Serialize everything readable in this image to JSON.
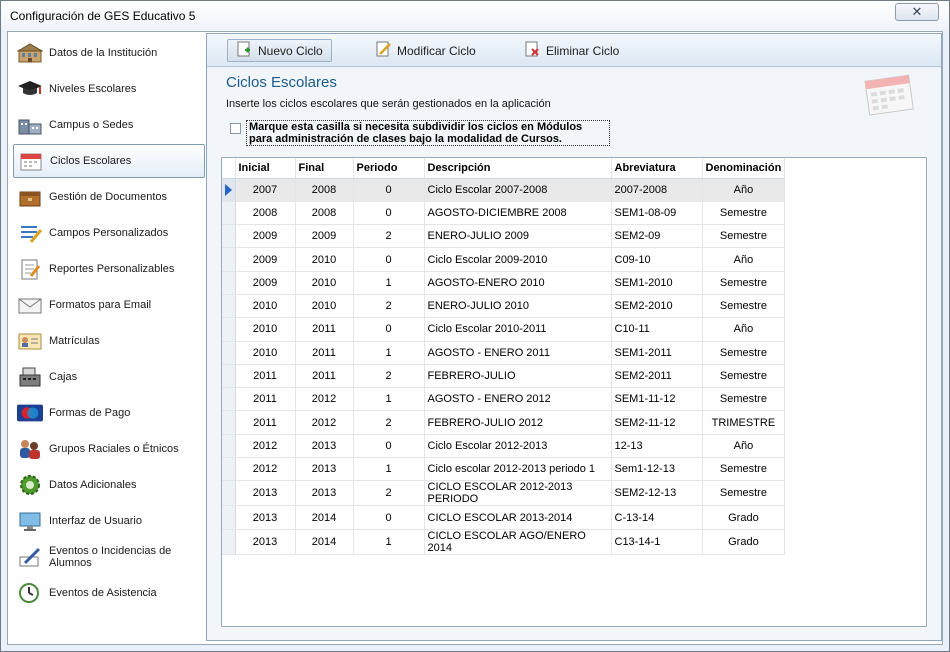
{
  "window": {
    "title": "Configuración de GES Educativo 5",
    "close_glyph": "✕"
  },
  "sidebar": {
    "items": [
      {
        "label": "Datos de la Institución",
        "icon": "school-building-icon"
      },
      {
        "label": "Niveles Escolares",
        "icon": "graduation-cap-icon"
      },
      {
        "label": "Campus o Sedes",
        "icon": "campus-buildings-icon"
      },
      {
        "label": "Ciclos Escolares",
        "icon": "calendar-icon",
        "active": true
      },
      {
        "label": "Gestión de Documentos",
        "icon": "document-box-icon"
      },
      {
        "label": "Campos Personalizados",
        "icon": "custom-fields-icon"
      },
      {
        "label": "Reportes Personalizables",
        "icon": "report-icon"
      },
      {
        "label": "Formatos para Email",
        "icon": "email-icon"
      },
      {
        "label": "Matrículas",
        "icon": "id-card-icon"
      },
      {
        "label": "Cajas",
        "icon": "cash-register-icon"
      },
      {
        "label": "Formas de Pago",
        "icon": "maestro-card-icon"
      },
      {
        "label": "Grupos Raciales o Étnicos",
        "icon": "people-group-icon"
      },
      {
        "label": "Datos Adicionales",
        "icon": "gear-icon"
      },
      {
        "label": "Interfaz de Usuario",
        "icon": "monitor-icon"
      },
      {
        "label": "Eventos o Incidencias de Alumnos",
        "icon": "pen-note-icon"
      },
      {
        "label": "Eventos de Asistencia",
        "icon": "clock-icon"
      }
    ]
  },
  "toolbar": {
    "new_label": "Nuevo Ciclo",
    "edit_label": "Modificar Ciclo",
    "delete_label": "Eliminar Ciclo"
  },
  "content": {
    "heading": "Ciclos Escolares",
    "subtitle": "Inserte los ciclos escolares que serán gestionados en la aplicación",
    "checkbox_label": "Marque esta casilla si necesita subdividir los ciclos en Módulos para administración de clases bajo la modalidad de Cursos.",
    "checkbox_checked": false
  },
  "grid": {
    "columns": [
      "Inicial",
      "Final",
      "Periodo",
      "Descripción",
      "Abreviatura",
      "Denominación"
    ],
    "rows": [
      [
        "2007",
        "2008",
        "0",
        "Ciclo Escolar 2007-2008",
        "2007-2008",
        "Año"
      ],
      [
        "2008",
        "2008",
        "0",
        "AGOSTO-DICIEMBRE 2008",
        "SEM1-08-09",
        "Semestre"
      ],
      [
        "2009",
        "2009",
        "2",
        "ENERO-JULIO 2009",
        "SEM2-09",
        "Semestre"
      ],
      [
        "2009",
        "2010",
        "0",
        "Ciclo Escolar 2009-2010",
        "C09-10",
        "Año"
      ],
      [
        "2009",
        "2010",
        "1",
        "AGOSTO-ENERO 2010",
        "SEM1-2010",
        "Semestre"
      ],
      [
        "2010",
        "2010",
        "2",
        "ENERO-JULIO 2010",
        "SEM2-2010",
        "Semestre"
      ],
      [
        "2010",
        "2011",
        "0",
        "Ciclo Escolar 2010-2011",
        "C10-11",
        "Año"
      ],
      [
        "2010",
        "2011",
        "1",
        "AGOSTO - ENERO 2011",
        "SEM1-2011",
        "Semestre"
      ],
      [
        "2011",
        "2011",
        "2",
        "FEBRERO-JULIO",
        "SEM2-2011",
        "Semestre"
      ],
      [
        "2011",
        "2012",
        "1",
        "AGOSTO - ENERO 2012",
        "SEM1-11-12",
        "Semestre"
      ],
      [
        "2011",
        "2012",
        "2",
        "FEBRERO-JULIO 2012",
        "SEM2-11-12",
        "TRIMESTRE"
      ],
      [
        "2012",
        "2013",
        "0",
        "Ciclo Escolar 2012-2013",
        "12-13",
        "Año"
      ],
      [
        "2012",
        "2013",
        "1",
        "Ciclo escolar 2012-2013 periodo 1",
        "Sem1-12-13",
        "Semestre"
      ],
      [
        "2013",
        "2013",
        "2",
        "CICLO ESCOLAR 2012-2013 PERIODO",
        "SEM2-12-13",
        "Semestre"
      ],
      [
        "2013",
        "2014",
        "0",
        "CICLO ESCOLAR 2013-2014",
        "C-13-14",
        "Grado"
      ],
      [
        "2013",
        "2014",
        "1",
        "CICLO ESCOLAR AGO/ENERO 2014",
        "C13-14-1",
        "Grado"
      ]
    ],
    "current_row": 0
  },
  "colors": {
    "accent": "#1a5a8c",
    "selection_arrow": "#1f64c8"
  }
}
